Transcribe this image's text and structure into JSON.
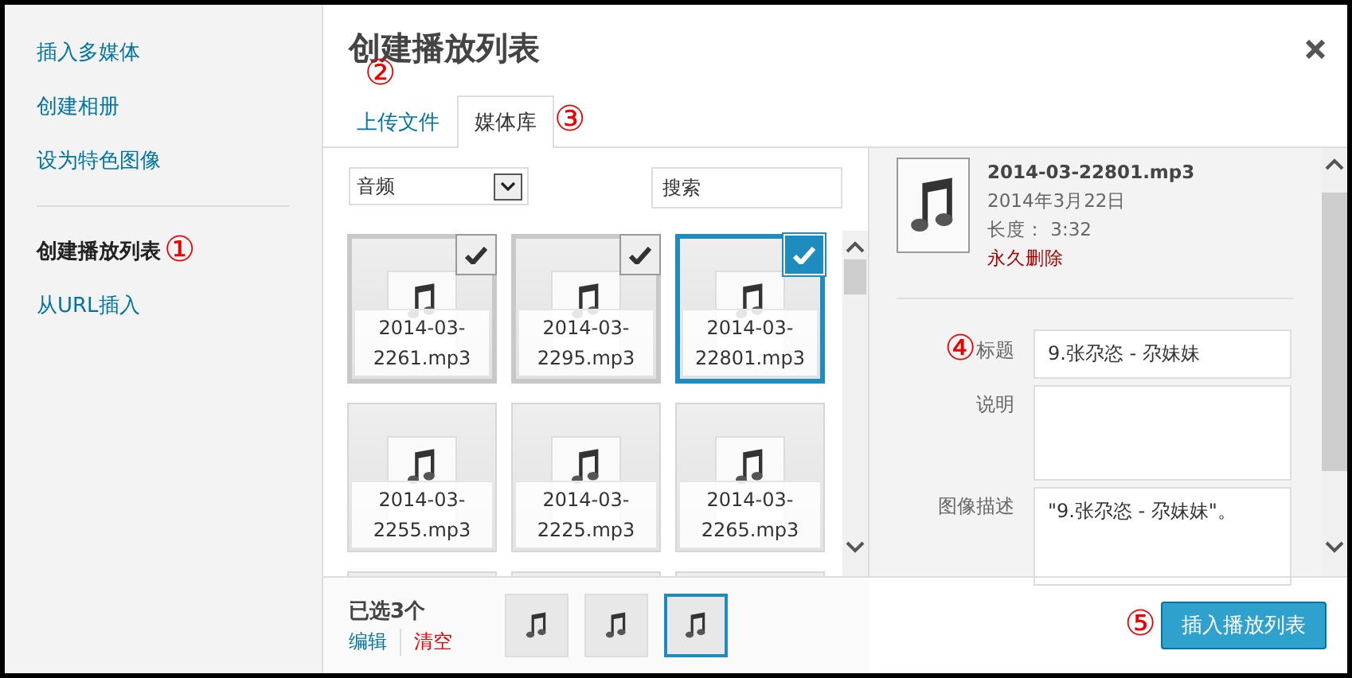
{
  "sidebar": {
    "sections": [
      {
        "items": [
          {
            "label": "插入多媒体",
            "selected": false
          },
          {
            "label": "创建相册",
            "selected": false
          },
          {
            "label": "设为特色图像",
            "selected": false
          }
        ]
      },
      {
        "items": [
          {
            "label": "创建播放列表",
            "selected": true,
            "annotation": "①"
          },
          {
            "label": "从URL插入",
            "selected": false
          }
        ]
      }
    ]
  },
  "dialog": {
    "title": "创建播放列表"
  },
  "tabs": [
    {
      "label": "上传文件",
      "selected": false,
      "annotation": "②"
    },
    {
      "label": "媒体库",
      "selected": true,
      "annotation": "③"
    }
  ],
  "filter": {
    "value": "音频"
  },
  "search": {
    "placeholder": "搜索"
  },
  "attachments": [
    {
      "name": "2014-03-2261.mp3",
      "checked": true,
      "current": false
    },
    {
      "name": "2014-03-2295.mp3",
      "checked": true,
      "current": false
    },
    {
      "name": "2014-03-22801.mp3",
      "checked": true,
      "current": true
    },
    {
      "name": "2014-03-2255.mp3",
      "checked": false,
      "current": false
    },
    {
      "name": "2014-03-2225.mp3",
      "checked": false,
      "current": false
    },
    {
      "name": "2014-03-2265.mp3",
      "checked": false,
      "current": false
    },
    {
      "checked": false,
      "current": false
    },
    {
      "checked": false,
      "current": false
    },
    {
      "checked": false,
      "current": false
    }
  ],
  "details": {
    "filename": "2014-03-22801.mp3",
    "date": "2014年3月22日",
    "length": "长度： 3:32",
    "delete": "永久删除",
    "fields": [
      {
        "label": "标题",
        "value": "9.张尕恣 - 尕妹妹",
        "annotation": "④",
        "kind": "input"
      },
      {
        "label": "说明",
        "kind": "textarea"
      },
      {
        "label": "图像描述",
        "value": "\"9.张尕恣 - 尕妹妹\"。",
        "kind": "textarea"
      }
    ]
  },
  "toolbar": {
    "count": "已选3个",
    "edit": "编辑",
    "clear": "清空",
    "selection": [
      {
        "current": false
      },
      {
        "current": false
      },
      {
        "current": true
      }
    ],
    "button": {
      "label": "插入播放列表",
      "annotation": "⑤"
    }
  }
}
